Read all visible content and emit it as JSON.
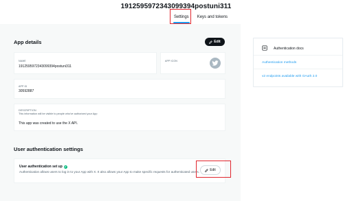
{
  "app": {
    "title": "1912595972343099394postuni311"
  },
  "tabs": [
    {
      "label": "Settings",
      "active": true
    },
    {
      "label": "Keys and tokens",
      "active": false
    }
  ],
  "app_details": {
    "heading": "App details",
    "edit_label": "Edit",
    "name_label": "NAME",
    "name_value": "1912595972343099394postuni311",
    "app_icon_label": "APP ICON",
    "app_id_label": "APP ID",
    "app_id_value": "30592887",
    "description_label": "DESCRIPTION",
    "description_hint": "This information will be visible to people who've authorized your App",
    "description_value": "This app was created to use the X API."
  },
  "user_auth": {
    "heading": "User authentication settings",
    "title": "User authentication set up",
    "description": "Authentication allows users to log in to your App with X. It also allows your App to make specific requests for authenticated users.",
    "edit_label": "Edit"
  },
  "docs": {
    "title": "Authentication docs",
    "links": [
      "Authentication methods",
      "v2 endpoints available with OAuth 2.0"
    ]
  },
  "icons": {
    "edit": "pencil-icon",
    "app_icon": "twitter-bird-icon",
    "status": "check-circle-icon",
    "docs": "document-icon"
  },
  "colors": {
    "accent": "#1d9bf0",
    "success": "#00ba7c",
    "highlight_box": "#e0242c",
    "primary_button": "#0f1419",
    "page_background": "#f7f9f9"
  }
}
